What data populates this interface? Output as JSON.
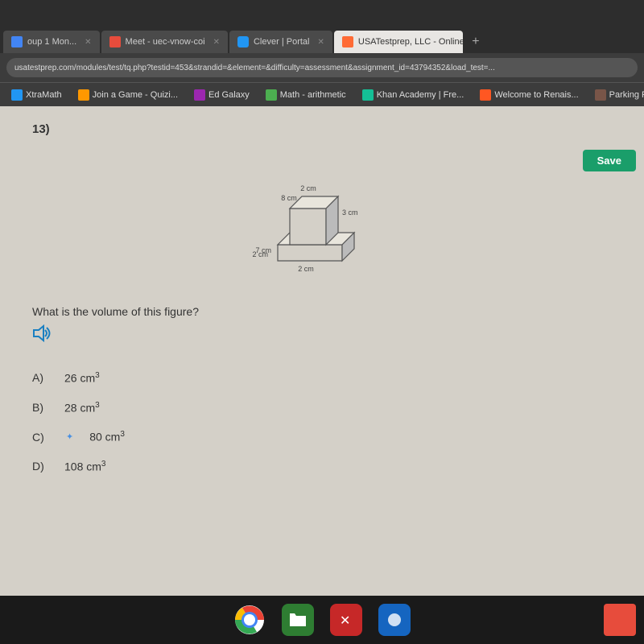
{
  "browser": {
    "tabs": [
      {
        "id": "tab1",
        "label": "oup 1 Mon...",
        "active": false,
        "favicon_color": "#4285f4"
      },
      {
        "id": "tab2",
        "label": "Meet - uec-vnow-coi",
        "active": false,
        "favicon_color": "#e74c3c"
      },
      {
        "id": "tab3",
        "label": "Clever | Portal",
        "active": false,
        "favicon_color": "#2196f3"
      },
      {
        "id": "tab4",
        "label": "USATestprep, LLC - Online State...",
        "active": true,
        "favicon_color": "#ff6b35"
      },
      {
        "id": "tab5",
        "label": "+",
        "active": false
      }
    ],
    "address": "usatestprep.com/modules/test/tq.php?testid=453&strandid=&element=&difficulty=assessment&assignment_id=43794352&load_test=...",
    "bookmarks": [
      {
        "id": "bm1",
        "label": "XtraMath",
        "icon_color": "#2196f3"
      },
      {
        "id": "bm2",
        "label": "Join a Game - Quizi...",
        "icon_color": "#ff9800"
      },
      {
        "id": "bm3",
        "label": "Ed Galaxy",
        "icon_color": "#9c27b0"
      },
      {
        "id": "bm4",
        "label": "Math - arithmetic",
        "icon_color": "#4caf50"
      },
      {
        "id": "bm5",
        "label": "Khan Academy | Fre...",
        "icon_color": "#14bf96"
      },
      {
        "id": "bm6",
        "label": "Welcome to Renais...",
        "icon_color": "#ff5722"
      },
      {
        "id": "bm7",
        "label": "Parking Fury",
        "icon_color": "#795548"
      }
    ]
  },
  "toolbar": {
    "save_label": "Save"
  },
  "question": {
    "number": "13)",
    "text": "What is the volume of this figure?",
    "figure_labels": {
      "top_width": "2 cm",
      "top_depth": "8 cm",
      "top_height": "3 cm",
      "bottom_length": "7 cm",
      "bottom_width": "2 cm",
      "bottom_depth": "2 cm"
    },
    "choices": [
      {
        "letter": "A)",
        "value": "26 cm",
        "superscript": "3",
        "selected": false
      },
      {
        "letter": "B)",
        "value": "28 cm",
        "superscript": "3",
        "selected": false
      },
      {
        "letter": "C)",
        "value": "80 cm",
        "superscript": "3",
        "selected": true
      },
      {
        "letter": "D)",
        "value": "108 cm",
        "superscript": "3",
        "selected": false
      }
    ]
  },
  "taskbar": {
    "icons": [
      {
        "id": "chrome",
        "label": "Chrome",
        "type": "chrome"
      },
      {
        "id": "files",
        "label": "Files",
        "type": "green"
      },
      {
        "id": "game",
        "label": "Game",
        "type": "red-x"
      },
      {
        "id": "app",
        "label": "App",
        "type": "blue"
      }
    ]
  }
}
